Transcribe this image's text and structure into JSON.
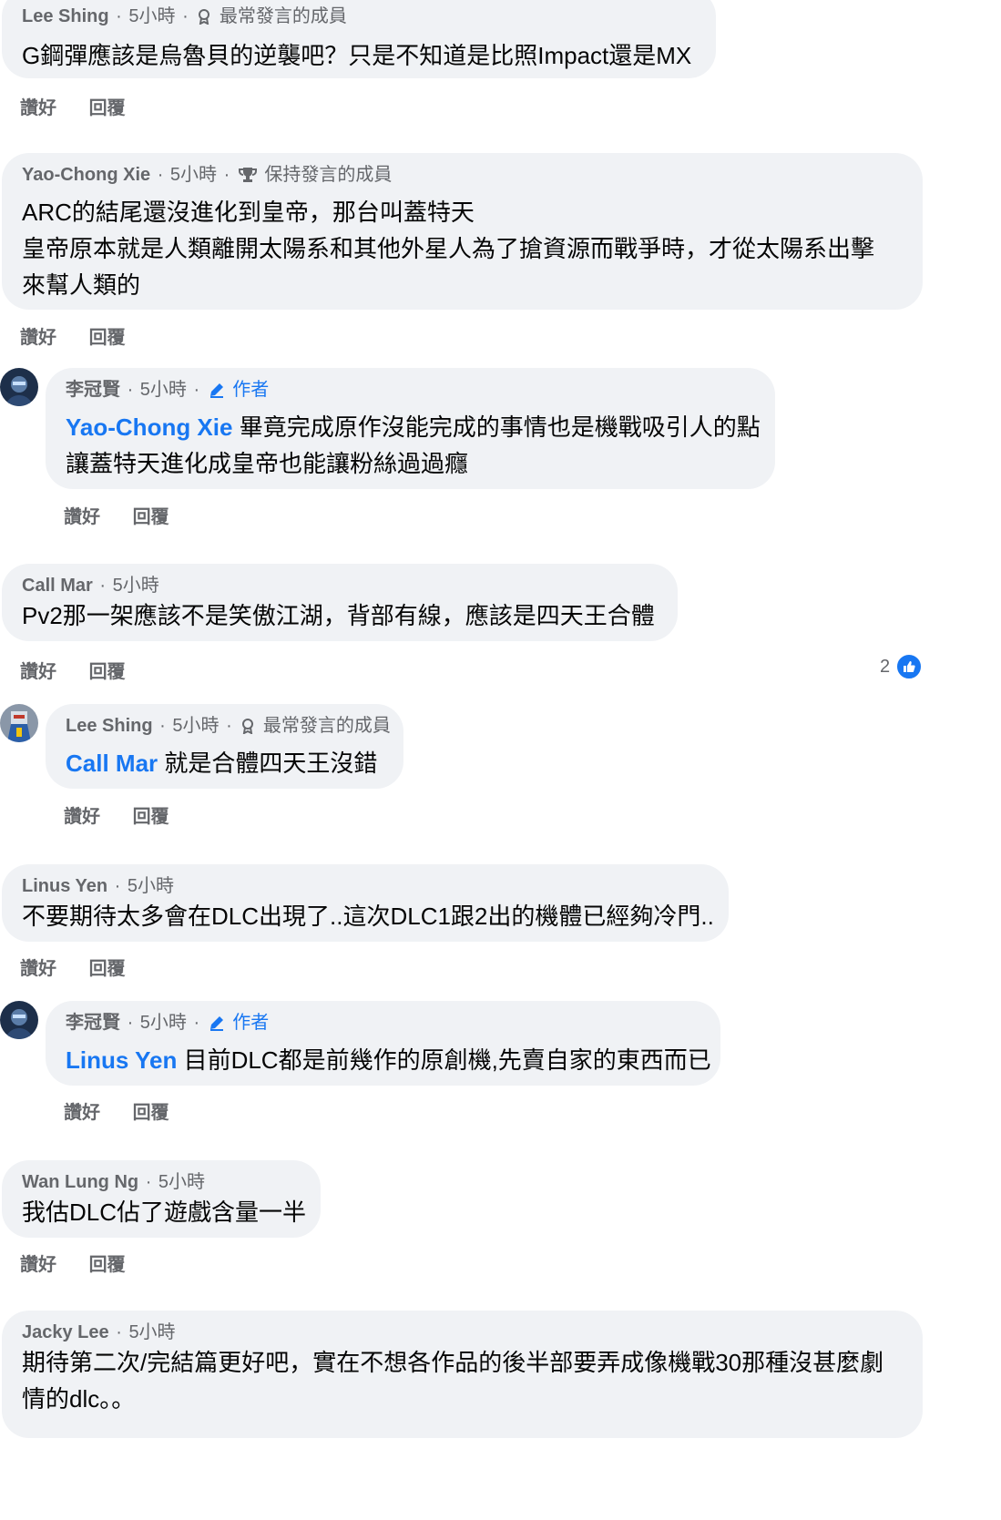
{
  "actions": {
    "like": "讚好",
    "reply": "回覆"
  },
  "comments": [
    {
      "name": "Lee Shing",
      "time": "5小時",
      "badge": "最常發言的成員",
      "lines": [
        "G鋼彈應該是烏魯貝的逆襲吧？只是不知道是比照Impact還是MX"
      ]
    },
    {
      "name": "Yao-Chong Xie",
      "time": "5小時",
      "badge": "保持發言的成員",
      "lines": [
        "ARC的結尾還沒進化到皇帝，那台叫蓋特天",
        "皇帝原本就是人類離開太陽系和其他外星人為了搶資源而戰爭時，才從太陽系出擊",
        "來幫人類的"
      ]
    },
    {
      "name": "李冠賢",
      "time": "5小時",
      "badge": "作者",
      "mention": "Yao-Chong Xie",
      "lines": [
        " 畢竟完成原作沒能完成的事情也是機戰吸引人的點",
        "讓蓋特天進化成皇帝也能讓粉絲過過癮"
      ]
    },
    {
      "name": "Call Mar",
      "time": "5小時",
      "lines": [
        "Pv2那一架應該不是笑傲江湖，背部有線，應該是四天王合體"
      ],
      "reaction_count": "2"
    },
    {
      "name": "Lee Shing",
      "time": "5小時",
      "badge": "最常發言的成員",
      "mention": "Call Mar",
      "lines": [
        " 就是合體四天王沒錯"
      ]
    },
    {
      "name": "Linus Yen",
      "time": "5小時",
      "lines": [
        "不要期待太多會在DLC出現了..這次DLC1跟2出的機體已經夠冷門.."
      ]
    },
    {
      "name": "李冠賢",
      "time": "5小時",
      "badge": "作者",
      "mention": "Linus Yen",
      "lines": [
        " 目前DLC都是前幾作的原創機,先賣自家的東西而已"
      ]
    },
    {
      "name": "Wan Lung Ng",
      "time": "5小時",
      "lines": [
        "我估DLC佔了遊戲含量一半"
      ]
    },
    {
      "name": "Jacky  Lee",
      "time": "5小時",
      "lines": [
        "期待第二次/完結篇更好吧，實在不想各作品的後半部要弄成像機戰30那種沒甚麼劇",
        "情的dlc。。"
      ]
    }
  ],
  "icons": {
    "top_fan": "badge-icon",
    "rising": "trophy-icon",
    "author": "pencil-icon",
    "like": "thumbs-up-icon"
  },
  "colors": {
    "bubble": "#f0f2f5",
    "link": "#1877f2",
    "meta": "#65676b"
  }
}
